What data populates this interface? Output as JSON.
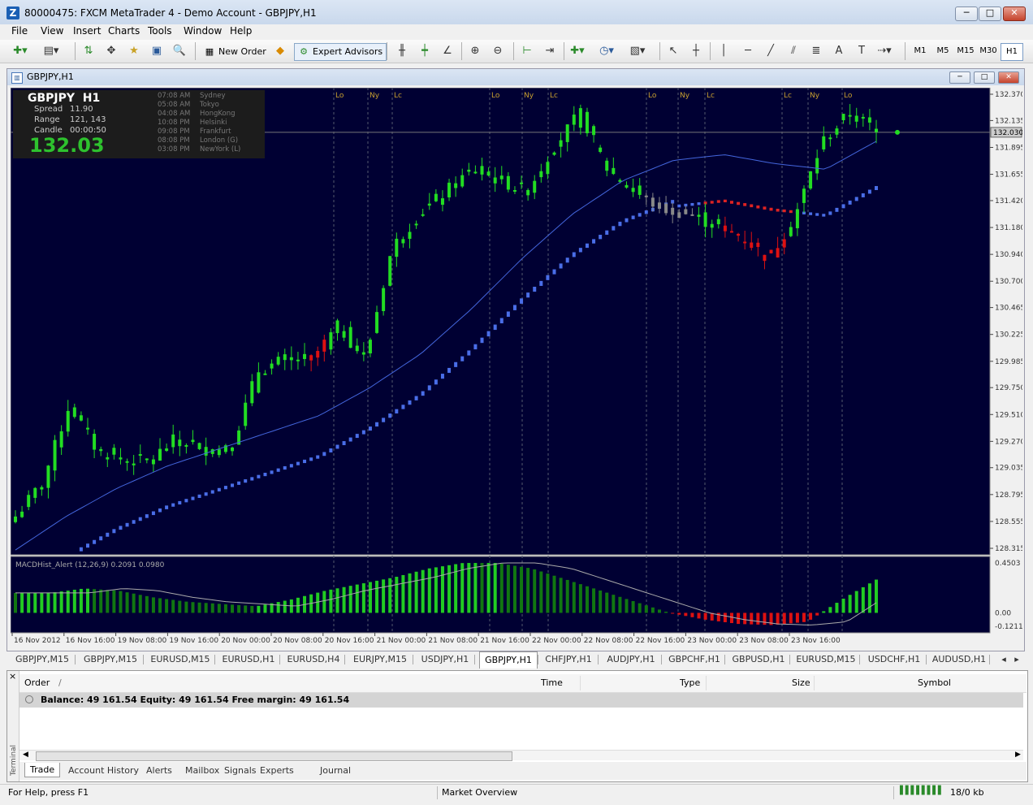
{
  "window": {
    "title": "80000475: FXCM MetaTrader 4 - Demo Account - GBPJPY,H1",
    "minimize": "─",
    "maximize": "□",
    "close": "✕"
  },
  "menu": [
    "File",
    "View",
    "Insert",
    "Charts",
    "Tools",
    "Window",
    "Help"
  ],
  "toolbar": {
    "new_order": "New Order",
    "expert_advisors": "Expert Advisors",
    "timeframes": [
      "M1",
      "M5",
      "M15",
      "M30",
      "H1"
    ],
    "active_timeframe": "H1",
    "icons": [
      "new-chart-icon",
      "profiles-icon",
      "market-watch-icon",
      "navigator-icon",
      "data-window-icon",
      "terminal-icon",
      "strategy-tester-icon",
      "zoom-in-icon",
      "zoom-out-icon",
      "chart-shift-icon",
      "autoscroll-icon",
      "indicators-icon",
      "periods-icon",
      "templates-icon",
      "cursor-icon",
      "crosshair-icon",
      "vertical-line-icon",
      "horizontal-line-icon",
      "trendline-icon",
      "channel-icon",
      "fibonacci-icon",
      "text-icon",
      "label-icon",
      "arrows-icon"
    ]
  },
  "chart_window": {
    "title": "GBPJPY,H1",
    "info": {
      "symbol": "GBPJPY",
      "timeframe": "H1",
      "spread_label": "Spread",
      "spread": "11.90",
      "range_label": "Range",
      "range": "121, 143",
      "candle_label": "Candle",
      "candle": "00:00:50",
      "price": "132.03",
      "sessions": [
        {
          "time": "07:08 AM",
          "city": "Sydney"
        },
        {
          "time": "05:08 AM",
          "city": "Tokyo"
        },
        {
          "time": "04:08 AM",
          "city": "HongKong"
        },
        {
          "time": "10:08 PM",
          "city": "Helsinki"
        },
        {
          "time": "09:08 PM",
          "city": "Frankfurt"
        },
        {
          "time": "08:08 PM",
          "city": "London  (G)"
        },
        {
          "time": "03:08 PM",
          "city": "NewYork  (L)"
        }
      ]
    },
    "indicator_label": "MACDHist_Alert (12,26,9)  0.2091 0.0980",
    "session_markers": [
      "Lo",
      "Ny",
      "Lc",
      "Lo",
      "Ny",
      "Lc",
      "Lo",
      "Ny",
      "Lc",
      "Lc",
      "Ny",
      "Lo"
    ],
    "current_price_label": "132.030"
  },
  "chart_data": {
    "type": "candlestick",
    "symbol": "GBPJPY",
    "timeframe": "H1",
    "price_axis": [
      "132.370",
      "132.135",
      "131.895",
      "131.655",
      "131.420",
      "131.180",
      "130.940",
      "130.700",
      "130.465",
      "130.225",
      "129.985",
      "129.750",
      "129.510",
      "129.270",
      "129.035",
      "128.795",
      "128.555",
      "128.315"
    ],
    "ylim": [
      128.315,
      132.37
    ],
    "macd_axis": [
      "0.4503",
      "0.00",
      "-0.1211"
    ],
    "time_axis": [
      "16 Nov 2012",
      "16 Nov 16:00",
      "19 Nov 08:00",
      "19 Nov 16:00",
      "20 Nov 00:00",
      "20 Nov 08:00",
      "20 Nov 16:00",
      "21 Nov 00:00",
      "21 Nov 08:00",
      "21 Nov 16:00",
      "22 Nov 00:00",
      "22 Nov 08:00",
      "22 Nov 16:00",
      "23 Nov 00:00",
      "23 Nov 08:00",
      "23 Nov 16:00"
    ],
    "close_anchors": [
      128.6,
      128.9,
      129.6,
      129.2,
      129.1,
      129.1,
      129.3,
      129.2,
      129.2,
      129.9,
      130.0,
      130.0,
      130.3,
      130.0,
      131.0,
      131.3,
      131.5,
      131.7,
      131.6,
      131.5,
      131.9,
      132.2,
      131.7,
      131.5,
      131.35,
      131.3,
      131.2,
      131.1,
      130.9,
      131.3,
      131.95,
      132.2,
      132.05
    ],
    "ma_anchors": [
      128.3,
      128.6,
      128.85,
      129.05,
      129.2,
      129.35,
      129.5,
      129.75,
      130.05,
      130.45,
      130.9,
      131.3,
      131.6,
      131.78,
      131.83,
      131.75,
      131.7,
      131.95
    ],
    "macd_anchors": [
      0.18,
      0.18,
      0.22,
      0.2,
      0.14,
      0.1,
      0.08,
      0.06,
      0.12,
      0.2,
      0.26,
      0.32,
      0.4,
      0.45,
      0.45,
      0.4,
      0.3,
      0.2,
      0.1,
      0.0,
      -0.06,
      -0.1,
      -0.11,
      -0.08,
      0.12,
      0.3
    ]
  },
  "symbol_tabs": [
    "GBPJPY,M15",
    "GBPJPY,M15",
    "EURUSD,M15",
    "EURUSD,H1",
    "EURUSD,H4",
    "EURJPY,M15",
    "USDJPY,H1",
    "GBPJPY,H1",
    "CHFJPY,H1",
    "AUDJPY,H1",
    "GBPCHF,H1",
    "GBPUSD,H1",
    "EURUSD,M15",
    "USDCHF,H1",
    "AUDUSD,H1"
  ],
  "active_symbol_tab": "GBPJPY,H1",
  "terminal": {
    "side_label": "Terminal",
    "close": "×",
    "columns": [
      "Order",
      "Time",
      "Type",
      "Size",
      "Symbol"
    ],
    "sort_indicator": "/",
    "balance_row": "Balance: 49 161.54  Equity: 49 161.54  Free margin: 49 161.54",
    "tabs": [
      "Trade",
      "Account History",
      "Alerts",
      "Mailbox",
      "Signals",
      "Experts",
      "Journal"
    ],
    "active_tab": "Trade"
  },
  "status": {
    "help": "For Help, press F1",
    "profile": "Market Overview",
    "traffic": "18/0 kb"
  }
}
